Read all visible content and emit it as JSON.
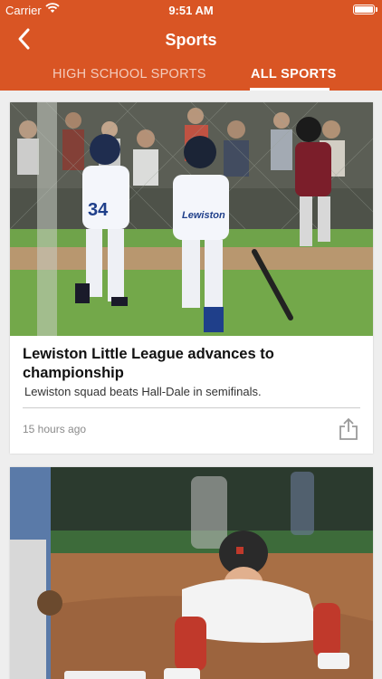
{
  "status": {
    "carrier": "Carrier",
    "time": "9:51 AM"
  },
  "nav": {
    "title": "Sports",
    "back_icon": "chevron-left-icon"
  },
  "tabs": [
    {
      "label": "HIGH SCHOOL SPORTS",
      "active": false
    },
    {
      "label": "ALL SPORTS",
      "active": true
    }
  ],
  "articles": [
    {
      "title": "Lewiston Little League advances to championship",
      "summary": "Lewiston squad beats Hall-Dale in semifinals.",
      "time": "15 hours ago",
      "jersey_number": "34",
      "jersey_name": "Lewiston",
      "share_icon": "share-icon"
    },
    {
      "image": "baseball-player-sliding-into-base"
    }
  ],
  "colors": {
    "accent": "#d95524",
    "background": "#eeeeee",
    "card": "#ffffff"
  }
}
